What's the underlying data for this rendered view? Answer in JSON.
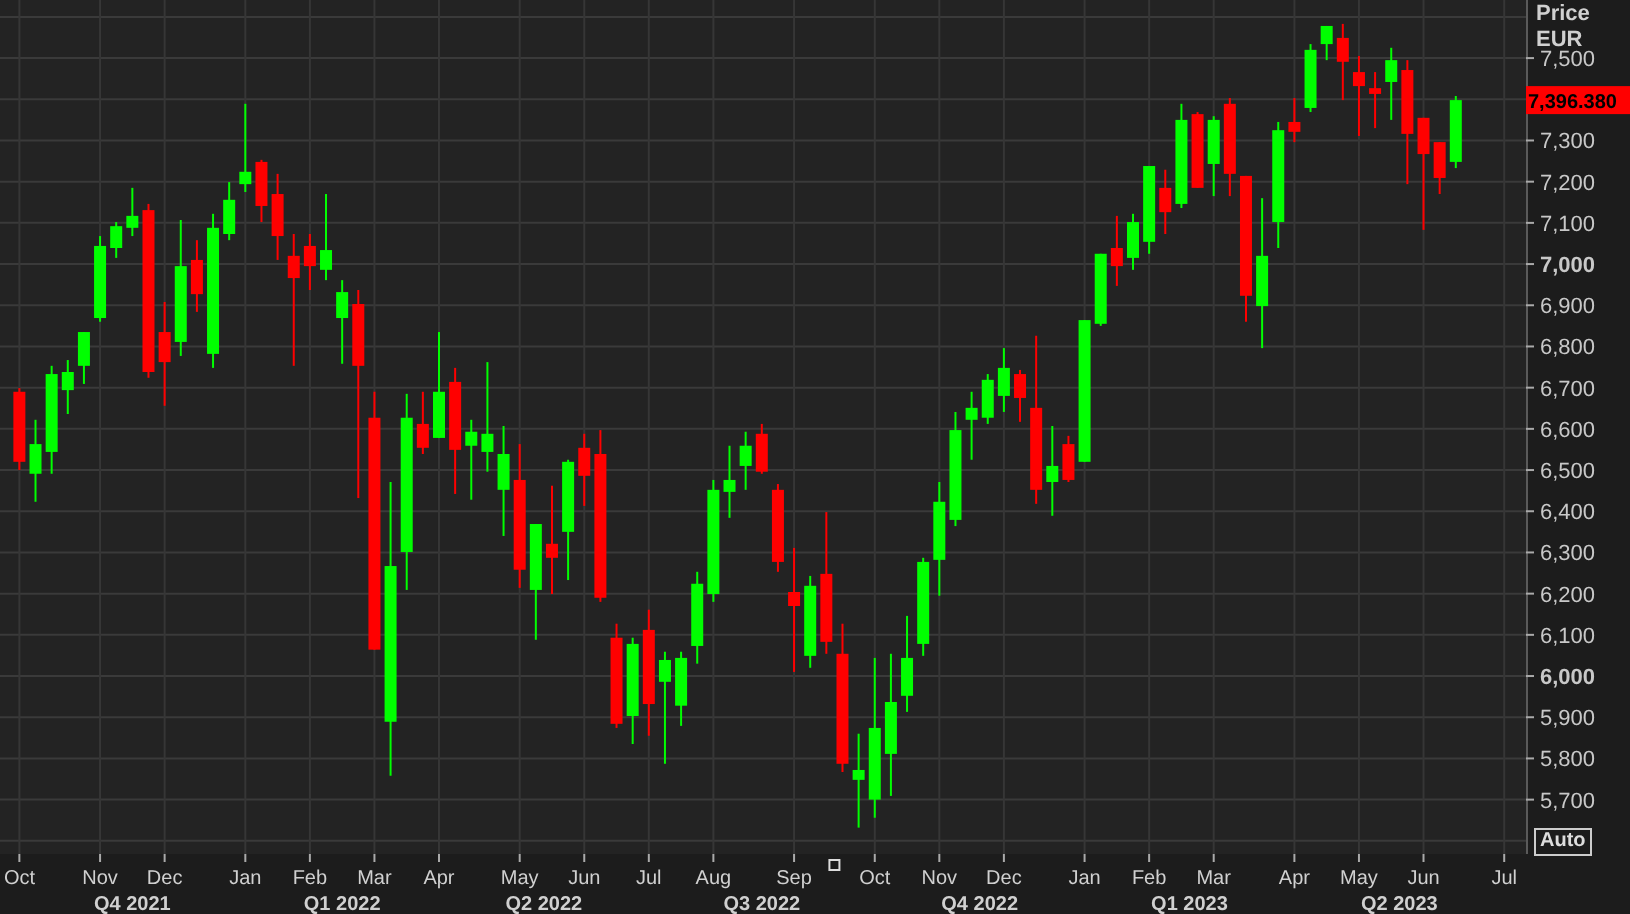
{
  "chart": {
    "chart_data": {
      "type": "candlestick",
      "ylabel": "Price",
      "grid": true,
      "ylim": [
        5568,
        7641
      ],
      "categories": [
        "Oct",
        null,
        null,
        null,
        null,
        "Nov",
        null,
        null,
        null,
        "Dec",
        null,
        null,
        null,
        null,
        "Jan",
        null,
        null,
        null,
        "Feb",
        null,
        null,
        null,
        "Mar",
        null,
        null,
        null,
        "Apr",
        null,
        null,
        null,
        null,
        "May",
        null,
        null,
        null,
        "Jun",
        null,
        null,
        null,
        "Jul",
        null,
        null,
        null,
        "Aug",
        null,
        null,
        null,
        null,
        "Sep",
        null,
        null,
        null,
        null,
        "Oct",
        null,
        null,
        null,
        "Nov",
        null,
        null,
        null,
        "Dec",
        null,
        null,
        null,
        null,
        "Jan",
        null,
        null,
        null,
        "Feb",
        null,
        null,
        null,
        "Mar",
        null,
        null,
        null,
        null,
        "Apr",
        null,
        null,
        null,
        "May",
        null,
        null,
        null,
        "Jun",
        null,
        null,
        null,
        null,
        "Jul"
      ],
      "ohlc": [
        [
          6690,
          6699,
          6500,
          6520
        ],
        [
          6491,
          6622,
          6423,
          6563
        ],
        [
          6544,
          6753,
          6491,
          6733
        ],
        [
          6694,
          6767,
          6636,
          6738
        ],
        [
          6753,
          6835,
          6709,
          6835
        ],
        [
          6869,
          7068,
          6860,
          7044
        ],
        [
          7039,
          7102,
          7015,
          7092
        ],
        [
          7088,
          7185,
          7068,
          7117
        ],
        [
          7131,
          7146,
          6724,
          6738
        ],
        [
          6835,
          6908,
          6656,
          6762
        ],
        [
          6811,
          7107,
          6777,
          6995
        ],
        [
          7010,
          7058,
          6884,
          6927
        ],
        [
          6782,
          7122,
          6748,
          7088
        ],
        [
          7073,
          7199,
          7058,
          7156
        ],
        [
          7194,
          7389,
          7175,
          7224
        ],
        [
          7248,
          7253,
          7102,
          7141
        ],
        [
          7170,
          7219,
          7010,
          7068
        ],
        [
          7020,
          7073,
          6753,
          6966
        ],
        [
          7044,
          7073,
          6937,
          6995
        ],
        [
          6986,
          7170,
          6961,
          7034
        ],
        [
          6869,
          6961,
          6758,
          6932
        ],
        [
          6903,
          6937,
          6432,
          6753
        ],
        [
          6627,
          6690,
          6064,
          6064
        ],
        [
          5889,
          6471,
          5758,
          6267
        ],
        [
          6301,
          6685,
          6209,
          6627
        ],
        [
          6612,
          6690,
          6539,
          6554
        ],
        [
          6578,
          6835,
          6578,
          6690
        ],
        [
          6714,
          6748,
          6442,
          6549
        ],
        [
          6559,
          6622,
          6428,
          6593
        ],
        [
          6544,
          6762,
          6496,
          6588
        ],
        [
          6452,
          6607,
          6340,
          6539
        ],
        [
          6476,
          6563,
          6214,
          6258
        ],
        [
          6209,
          6369,
          6088,
          6369
        ],
        [
          6321,
          6462,
          6199,
          6287
        ],
        [
          6350,
          6525,
          6233,
          6520
        ],
        [
          6554,
          6588,
          6413,
          6486
        ],
        [
          6539,
          6597,
          6180,
          6190
        ],
        [
          6093,
          6127,
          5874,
          5884
        ],
        [
          5903,
          6093,
          5835,
          6078
        ],
        [
          6112,
          6161,
          5855,
          5932
        ],
        [
          5986,
          6059,
          5787,
          6039
        ],
        [
          5928,
          6059,
          5879,
          6044
        ],
        [
          6073,
          6253,
          6030,
          6224
        ],
        [
          6199,
          6476,
          6180,
          6452
        ],
        [
          6447,
          6559,
          6384,
          6476
        ],
        [
          6510,
          6593,
          6452,
          6559
        ],
        [
          6588,
          6612,
          6491,
          6496
        ],
        [
          6452,
          6466,
          6253,
          6277
        ],
        [
          6204,
          6311,
          6010,
          6170
        ],
        [
          6049,
          6243,
          6020,
          6219
        ],
        [
          6248,
          6398,
          6054,
          6083
        ],
        [
          6054,
          6127,
          5767,
          5787
        ],
        [
          5748,
          5860,
          5632,
          5772
        ],
        [
          5700,
          6044,
          5656,
          5874
        ],
        [
          5811,
          6054,
          5709,
          5937
        ],
        [
          5952,
          6146,
          5913,
          6044
        ],
        [
          6078,
          6287,
          6049,
          6277
        ],
        [
          6282,
          6471,
          6195,
          6423
        ],
        [
          6379,
          6641,
          6364,
          6597
        ],
        [
          6622,
          6690,
          6525,
          6651
        ],
        [
          6627,
          6733,
          6612,
          6719
        ],
        [
          6680,
          6796,
          6641,
          6748
        ],
        [
          6733,
          6743,
          6617,
          6675
        ],
        [
          6651,
          6826,
          6418,
          6452
        ],
        [
          6471,
          6607,
          6389,
          6510
        ],
        [
          6563,
          6583,
          6471,
          6476
        ],
        [
          6520,
          6864,
          6520,
          6864
        ],
        [
          6855,
          7025,
          6850,
          7025
        ],
        [
          7039,
          7117,
          6947,
          6995
        ],
        [
          7015,
          7122,
          6986,
          7102
        ],
        [
          7054,
          7238,
          7025,
          7238
        ],
        [
          7185,
          7229,
          7073,
          7126
        ],
        [
          7146,
          7389,
          7136,
          7350
        ],
        [
          7364,
          7369,
          7185,
          7185
        ],
        [
          7243,
          7359,
          7165,
          7350
        ],
        [
          7389,
          7403,
          7165,
          7219
        ],
        [
          7214,
          7214,
          6860,
          6923
        ],
        [
          6898,
          7160,
          6796,
          7020
        ],
        [
          7102,
          7345,
          7039,
          7325
        ],
        [
          7345,
          7403,
          7296,
          7321
        ],
        [
          7379,
          7534,
          7369,
          7520
        ],
        [
          7534,
          7578,
          7495,
          7578
        ],
        [
          7549,
          7583,
          7398,
          7491
        ],
        [
          7466,
          7505,
          7311,
          7432
        ],
        [
          7427,
          7466,
          7330,
          7413
        ],
        [
          7442,
          7525,
          7350,
          7495
        ],
        [
          7471,
          7495,
          7194,
          7316
        ],
        [
          7355,
          7355,
          7083,
          7267
        ],
        [
          7296,
          7296,
          7170,
          7209
        ],
        [
          7248,
          7408,
          7233,
          7398
        ],
        null,
        null,
        null
      ],
      "yticks": [
        {
          "value": 5700,
          "label": "5,700"
        },
        {
          "value": 5800,
          "label": "5,800"
        },
        {
          "value": 5900,
          "label": "5,900"
        },
        {
          "value": 6000,
          "label": "6,000"
        },
        {
          "value": 6100,
          "label": "6,100"
        },
        {
          "value": 6200,
          "label": "6,200"
        },
        {
          "value": 6300,
          "label": "6,300"
        },
        {
          "value": 6400,
          "label": "6,400"
        },
        {
          "value": 6500,
          "label": "6,500"
        },
        {
          "value": 6600,
          "label": "6,600"
        },
        {
          "value": 6700,
          "label": "6,700"
        },
        {
          "value": 6800,
          "label": "6,800"
        },
        {
          "value": 6900,
          "label": "6,900"
        },
        {
          "value": 7000,
          "label": "7,000"
        },
        {
          "value": 7100,
          "label": "7,100"
        },
        {
          "value": 7200,
          "label": "7,200"
        },
        {
          "value": 7300,
          "label": "7,300"
        },
        {
          "value": 7500,
          "label": "7,500"
        }
      ]
    },
    "quarters": [
      "Q4 2021",
      "Q1 2022",
      "Q2 2022",
      "Q3 2022",
      "Q4 2022",
      "Q1 2023",
      "Q2 2023"
    ],
    "currency": "EUR",
    "last_price": "7,396.380",
    "auto_button": "Auto"
  }
}
